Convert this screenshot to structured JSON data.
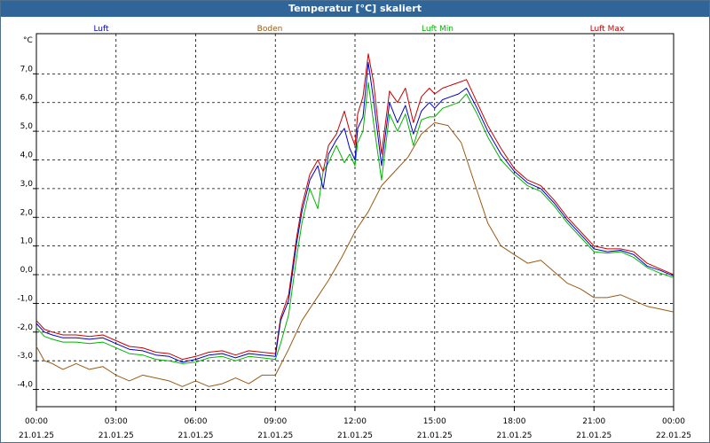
{
  "window": {
    "title": "Temperatur [°C] skaliert"
  },
  "chart_data": {
    "type": "line",
    "title": "Temperatur [°C] skaliert",
    "ylabel": "°C",
    "xlabel": "",
    "ylim": [
      -4.6,
      8.4
    ],
    "xlim": [
      0,
      24
    ],
    "grid": true,
    "legend_placement": "top",
    "y_ticks": [
      "7,0",
      "6,0",
      "5,0",
      "4,0",
      "3,0",
      "2,0",
      "1,0",
      "0,0",
      "-1,0",
      "-2,0",
      "-3,0",
      "-4,0"
    ],
    "y_tick_values": [
      7,
      6,
      5,
      4,
      3,
      2,
      1,
      0,
      -1,
      -2,
      -3,
      -4
    ],
    "x_ticks": [
      {
        "time": "00:00",
        "date": "21.01.25"
      },
      {
        "time": "03:00",
        "date": "21.01.25"
      },
      {
        "time": "06:00",
        "date": "21.01.25"
      },
      {
        "time": "09:00",
        "date": "21.01.25"
      },
      {
        "time": "12:00",
        "date": "21.01.25"
      },
      {
        "time": "15:00",
        "date": "21.01.25"
      },
      {
        "time": "18:00",
        "date": "21.01.25"
      },
      {
        "time": "21:00",
        "date": "21.01.25"
      },
      {
        "time": "00:00",
        "date": "22.01.25"
      }
    ],
    "x_tick_values": [
      0,
      3,
      6,
      9,
      12,
      15,
      18,
      21,
      24
    ],
    "series": [
      {
        "name": "Luft",
        "color": "#0000c8",
        "x": [
          0,
          0.3,
          0.6,
          1,
          1.5,
          2,
          2.5,
          3,
          3.5,
          4,
          4.5,
          5,
          5.5,
          6,
          6.5,
          7,
          7.5,
          8,
          8.5,
          9,
          9.2,
          9.5,
          9.8,
          10,
          10.3,
          10.6,
          10.8,
          11,
          11.3,
          11.6,
          11.8,
          12,
          12.1,
          12.3,
          12.5,
          12.7,
          13,
          13.3,
          13.6,
          13.9,
          14.2,
          14.5,
          14.8,
          15,
          15.3,
          15.6,
          15.9,
          16.2,
          16.6,
          17,
          17.5,
          18,
          18.5,
          19,
          19.5,
          20,
          20.5,
          21,
          21.5,
          22,
          22.5,
          23,
          23.5,
          24
        ],
        "y": [
          -1.7,
          -2.0,
          -2.1,
          -2.2,
          -2.2,
          -2.25,
          -2.2,
          -2.4,
          -2.6,
          -2.65,
          -2.8,
          -2.85,
          -3.05,
          -2.95,
          -2.8,
          -2.75,
          -2.9,
          -2.75,
          -2.8,
          -2.85,
          -1.6,
          -0.9,
          1.1,
          2.2,
          3.3,
          3.8,
          3.0,
          4.2,
          4.7,
          5.1,
          4.4,
          4.0,
          5.1,
          5.5,
          7.4,
          6.1,
          3.8,
          6.0,
          5.3,
          5.9,
          4.9,
          5.7,
          6.0,
          5.8,
          6.1,
          6.2,
          6.3,
          6.5,
          5.8,
          5.0,
          4.2,
          3.6,
          3.2,
          3.0,
          2.5,
          1.9,
          1.4,
          0.9,
          0.8,
          0.85,
          0.7,
          0.3,
          0.15,
          -0.05
        ]
      },
      {
        "name": "Boden",
        "color": "#9a5a14",
        "x": [
          0,
          0.3,
          0.6,
          1,
          1.5,
          2,
          2.5,
          3,
          3.5,
          4,
          4.5,
          5,
          5.5,
          6,
          6.5,
          7,
          7.5,
          8,
          8.5,
          9,
          9.5,
          10,
          10.5,
          11,
          11.5,
          12,
          12.5,
          13,
          13.5,
          14,
          14.5,
          15,
          15.5,
          16,
          16.5,
          17,
          17.5,
          18,
          18.5,
          19,
          19.5,
          20,
          20.5,
          21,
          21.5,
          22,
          22.5,
          23,
          23.5,
          24
        ],
        "y": [
          -2.5,
          -3.0,
          -3.1,
          -3.3,
          -3.1,
          -3.3,
          -3.2,
          -3.5,
          -3.7,
          -3.5,
          -3.6,
          -3.7,
          -3.9,
          -3.7,
          -3.9,
          -3.8,
          -3.6,
          -3.8,
          -3.5,
          -3.5,
          -2.6,
          -1.6,
          -0.9,
          -0.2,
          0.6,
          1.5,
          2.2,
          3.1,
          3.6,
          4.1,
          4.9,
          5.3,
          5.2,
          4.6,
          3.2,
          1.8,
          1.0,
          0.7,
          0.4,
          0.5,
          0.1,
          -0.3,
          -0.5,
          -0.8,
          -0.8,
          -0.7,
          -0.9,
          -1.1,
          -1.2,
          -1.3
        ]
      },
      {
        "name": "Luft Min",
        "color": "#00b400",
        "x": [
          0,
          0.3,
          0.6,
          1,
          1.5,
          2,
          2.5,
          3,
          3.5,
          4,
          4.5,
          5,
          5.5,
          6,
          6.5,
          7,
          7.5,
          8,
          8.5,
          9,
          9.2,
          9.5,
          9.8,
          10,
          10.3,
          10.6,
          10.8,
          11,
          11.3,
          11.6,
          11.8,
          12,
          12.1,
          12.3,
          12.5,
          12.7,
          13,
          13.3,
          13.6,
          13.9,
          14.2,
          14.5,
          14.8,
          15,
          15.3,
          15.6,
          15.9,
          16.2,
          16.6,
          17,
          17.5,
          18,
          18.5,
          19,
          19.5,
          20,
          20.5,
          21,
          21.5,
          22,
          22.5,
          23,
          23.5,
          24
        ],
        "y": [
          -1.85,
          -2.15,
          -2.25,
          -2.35,
          -2.35,
          -2.4,
          -2.35,
          -2.55,
          -2.75,
          -2.8,
          -2.95,
          -3.0,
          -3.1,
          -3.05,
          -2.9,
          -2.85,
          -3.0,
          -2.85,
          -2.9,
          -2.95,
          -2.4,
          -1.4,
          0.6,
          1.8,
          3.0,
          2.3,
          3.6,
          3.9,
          4.5,
          3.9,
          4.2,
          3.8,
          4.6,
          5.0,
          6.7,
          5.3,
          3.3,
          5.6,
          5.0,
          5.6,
          4.5,
          5.4,
          5.5,
          5.5,
          5.8,
          5.9,
          6.0,
          6.3,
          5.6,
          4.8,
          4.0,
          3.5,
          3.1,
          2.9,
          2.4,
          1.8,
          1.3,
          0.8,
          0.75,
          0.8,
          0.6,
          0.25,
          0.05,
          -0.1
        ]
      },
      {
        "name": "Luft Max",
        "color": "#c80000",
        "x": [
          0,
          0.3,
          0.6,
          1,
          1.5,
          2,
          2.5,
          3,
          3.5,
          4,
          4.5,
          5,
          5.5,
          6,
          6.5,
          7,
          7.5,
          8,
          8.5,
          9,
          9.2,
          9.5,
          9.8,
          10,
          10.3,
          10.6,
          10.8,
          11,
          11.3,
          11.6,
          11.8,
          12,
          12.1,
          12.3,
          12.5,
          12.7,
          13,
          13.3,
          13.6,
          13.9,
          14.2,
          14.5,
          14.8,
          15,
          15.3,
          15.6,
          15.9,
          16.2,
          16.6,
          17,
          17.5,
          18,
          18.5,
          19,
          19.5,
          20,
          20.5,
          21,
          21.5,
          22,
          22.5,
          23,
          23.5,
          24
        ],
        "y": [
          -1.6,
          -1.9,
          -2.0,
          -2.1,
          -2.1,
          -2.15,
          -2.1,
          -2.3,
          -2.5,
          -2.55,
          -2.7,
          -2.75,
          -2.95,
          -2.85,
          -2.7,
          -2.65,
          -2.8,
          -2.65,
          -2.7,
          -2.75,
          -1.5,
          -0.7,
          1.3,
          2.4,
          3.5,
          4.0,
          3.6,
          4.5,
          4.9,
          5.7,
          5.0,
          4.5,
          5.6,
          6.2,
          7.7,
          6.7,
          4.2,
          6.4,
          6.0,
          6.5,
          5.3,
          6.2,
          6.5,
          6.3,
          6.5,
          6.6,
          6.7,
          6.8,
          6.0,
          5.2,
          4.4,
          3.7,
          3.3,
          3.1,
          2.6,
          2.0,
          1.5,
          1.0,
          0.9,
          0.9,
          0.8,
          0.4,
          0.2,
          0.0
        ]
      }
    ]
  }
}
